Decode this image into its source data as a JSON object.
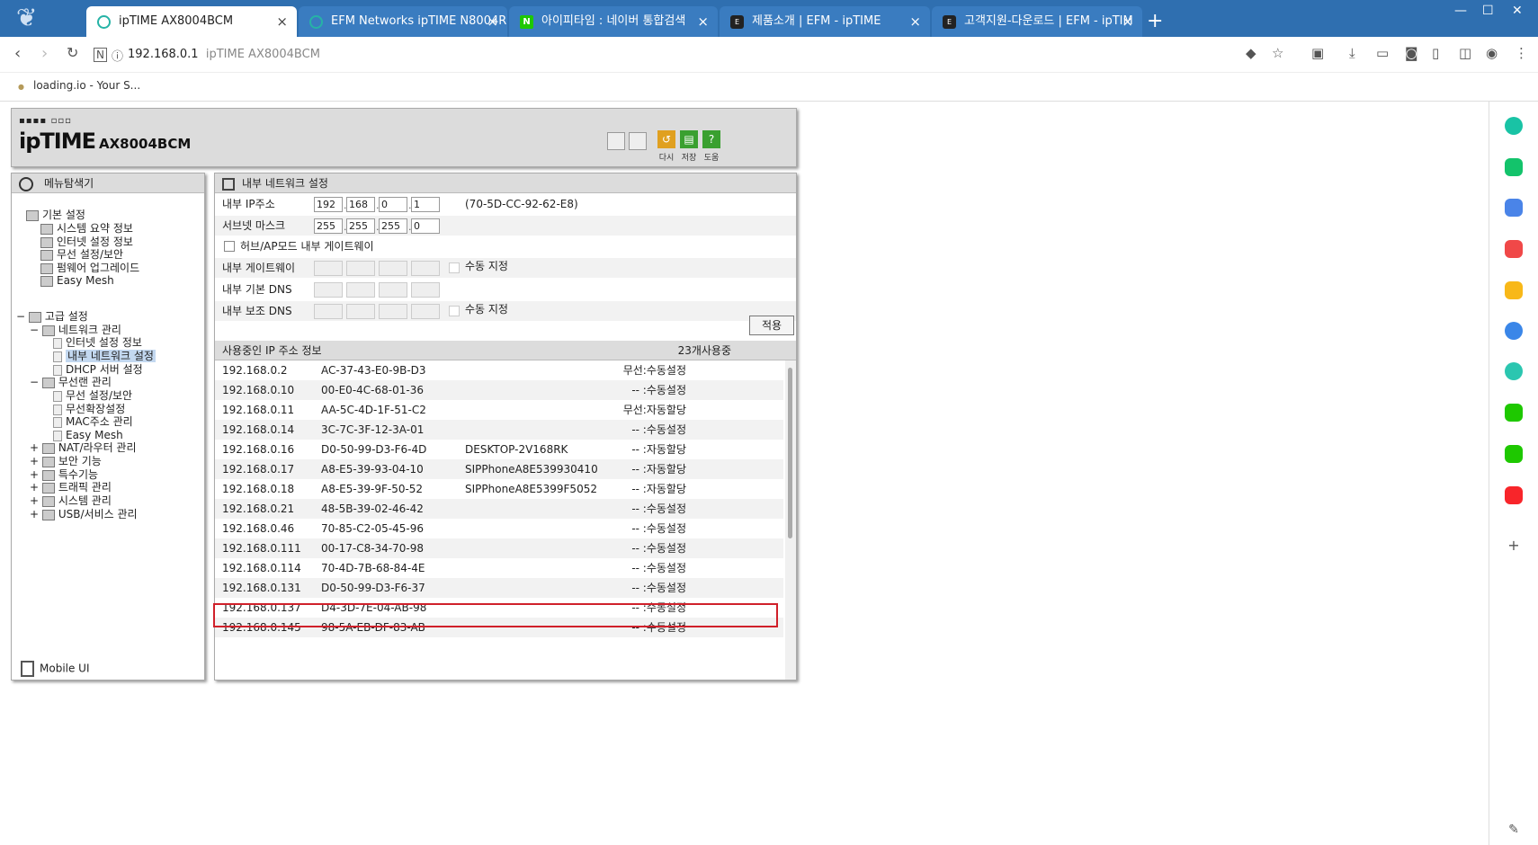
{
  "browser": {
    "tabs": [
      {
        "title": "ipTIME AX8004BCM",
        "active": true,
        "fav": "circle"
      },
      {
        "title": "EFM Networks ipTIME N8004R",
        "active": false,
        "fav": "circle"
      },
      {
        "title": "아이피타임 : 네이버 통합검색",
        "active": false,
        "fav": "N"
      },
      {
        "title": "제품소개 | EFM - ipTIME",
        "active": false,
        "fav": "E"
      },
      {
        "title": "고객지원-다운로드 | EFM - ipTIM",
        "active": false,
        "fav": "E"
      }
    ],
    "tab_close": "×",
    "new_tab": "+",
    "url_host": "192.168.0.1",
    "url_title": "ipTIME AX8004BCM",
    "bookmark": "loading.io - Your S..."
  },
  "router": {
    "model": "AX8004BCM",
    "brand": "ipTIME",
    "toolbar": {
      "refresh": "다시",
      "save": "저장",
      "help": "도움"
    },
    "menu_title": "메뉴탐색기",
    "mobile_ui": "Mobile UI",
    "tree": {
      "basic": "기본 설정",
      "basic_items": [
        "시스템 요약 정보",
        "인터넷 설정 정보",
        "무선 설정/보안",
        "펌웨어 업그레이드",
        "Easy Mesh"
      ],
      "advanced": "고급 설정",
      "network_mgmt": "네트워크 관리",
      "network_items": [
        "인터넷 설정 정보",
        "내부 네트워크 설정",
        "DHCP 서버 설정"
      ],
      "wireless_mgmt": "무선랜 관리",
      "wireless_items": [
        "무선 설정/보안",
        "무선확장설정",
        "MAC주소 관리",
        "Easy Mesh"
      ],
      "other_groups": [
        "NAT/라우터 관리",
        "보안 기능",
        "특수기능",
        "트래픽 관리",
        "시스템 관리",
        "USB/서비스 관리"
      ]
    },
    "main": {
      "title": "내부 네트워크 설정",
      "ip_label": "내부 IP주소",
      "ip": [
        "192",
        "168",
        "0",
        "1"
      ],
      "mac": "(70-5D-CC-92-62-E8)",
      "mask_label": "서브넷 마스크",
      "mask": [
        "255",
        "255",
        "255",
        "0"
      ],
      "hub_label": "허브/AP모드 내부 게이트웨이",
      "gw_label": "내부 게이트웨이",
      "manual_label": "수동 지정",
      "dns1_label": "내부 기본 DNS",
      "dns2_label": "내부 보조 DNS",
      "apply": "적용",
      "list_title": "사용중인 IP 주소 정보",
      "list_count": "23개사용중",
      "rows": [
        [
          "192.168.0.2",
          "AC-37-43-E0-9B-D3",
          "",
          "무선:수동설정"
        ],
        [
          "192.168.0.10",
          "00-E0-4C-68-01-36",
          "",
          "-- :수동설정"
        ],
        [
          "192.168.0.11",
          "AA-5C-4D-1F-51-C2",
          "",
          "무선:자동할당"
        ],
        [
          "192.168.0.14",
          "3C-7C-3F-12-3A-01",
          "",
          "-- :수동설정"
        ],
        [
          "192.168.0.16",
          "D0-50-99-D3-F6-4D",
          "DESKTOP-2V168RK",
          "-- :자동할당"
        ],
        [
          "192.168.0.17",
          "A8-E5-39-93-04-10",
          "SIPPhoneA8E539930410",
          "-- :자동할당"
        ],
        [
          "192.168.0.18",
          "A8-E5-39-9F-50-52",
          "SIPPhoneA8E5399F5052",
          "-- :자동할당"
        ],
        [
          "192.168.0.21",
          "48-5B-39-02-46-42",
          "",
          "-- :수동설정"
        ],
        [
          "192.168.0.46",
          "70-85-C2-05-45-96",
          "",
          "-- :수동설정"
        ],
        [
          "192.168.0.111",
          "00-17-C8-34-70-98",
          "",
          "-- :수동설정"
        ],
        [
          "192.168.0.114",
          "70-4D-7B-68-84-4E",
          "",
          "-- :수동설정"
        ],
        [
          "192.168.0.131",
          "D0-50-99-D3-F6-37",
          "",
          "-- :수동설정"
        ],
        [
          "192.168.0.137",
          "D4-3D-7E-04-AB-98",
          "",
          "-- :수동설정"
        ],
        [
          "192.168.0.145",
          "98-5A-EB-DF-83-AB",
          "",
          "-- :수동설정"
        ]
      ]
    }
  }
}
